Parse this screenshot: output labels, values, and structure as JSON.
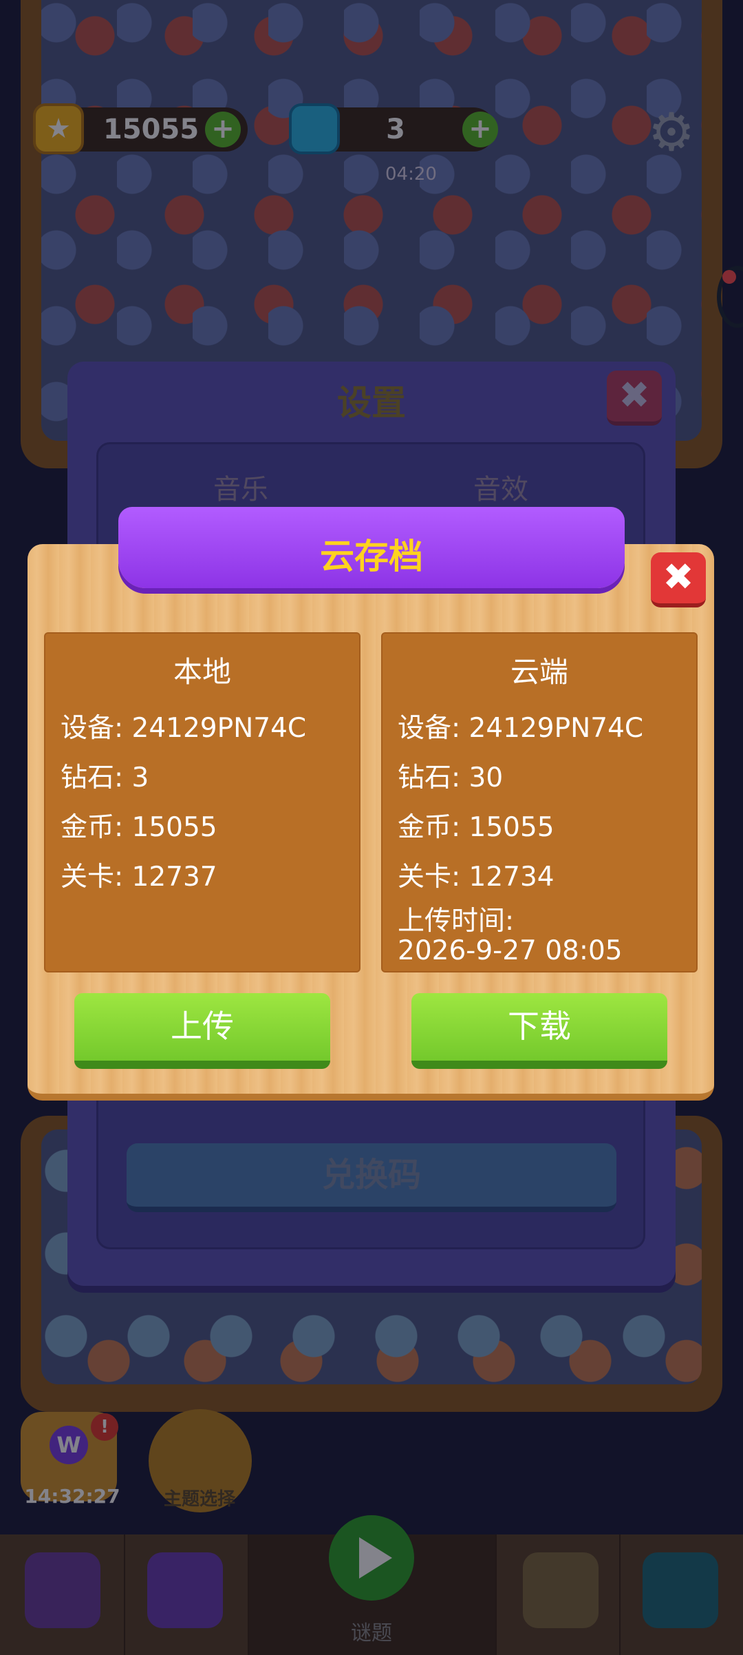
{
  "hud": {
    "coins": "15055",
    "gems": "3",
    "timer": "04:20",
    "plus": "+"
  },
  "settings": {
    "title": "设置",
    "music_label": "音乐",
    "sfx_label": "音效",
    "redeem_label": "兑换码"
  },
  "cloud_save": {
    "title": "云存档",
    "local": {
      "title": "本地",
      "device": "设备: 24129PN74C",
      "diamonds": "钻石: 3",
      "coins": "金币: 15055",
      "level": "关卡: 12737"
    },
    "cloud": {
      "title": "云端",
      "device": "设备: 24129PN74C",
      "diamonds": "钻石: 30",
      "coins": "金币: 15055",
      "level": "关卡: 12734",
      "upload_time_label": "上传时间:",
      "upload_time": "2026-9-27 08:05"
    },
    "upload_button": "上传",
    "download_button": "下载",
    "close_glyph": "✖"
  },
  "side_widgets": {
    "daily_time": "14:32:27",
    "daily_letter": "W",
    "daily_alert": "!",
    "theme_label": "主题选择"
  },
  "bottom_nav": {
    "active_label": "谜题"
  },
  "colors": {
    "ribbon_purple": "#9b45f2",
    "title_yellow": "#ffd21f",
    "button_green": "#86d634",
    "close_red": "#e23737",
    "box_brown": "#b86f26"
  }
}
